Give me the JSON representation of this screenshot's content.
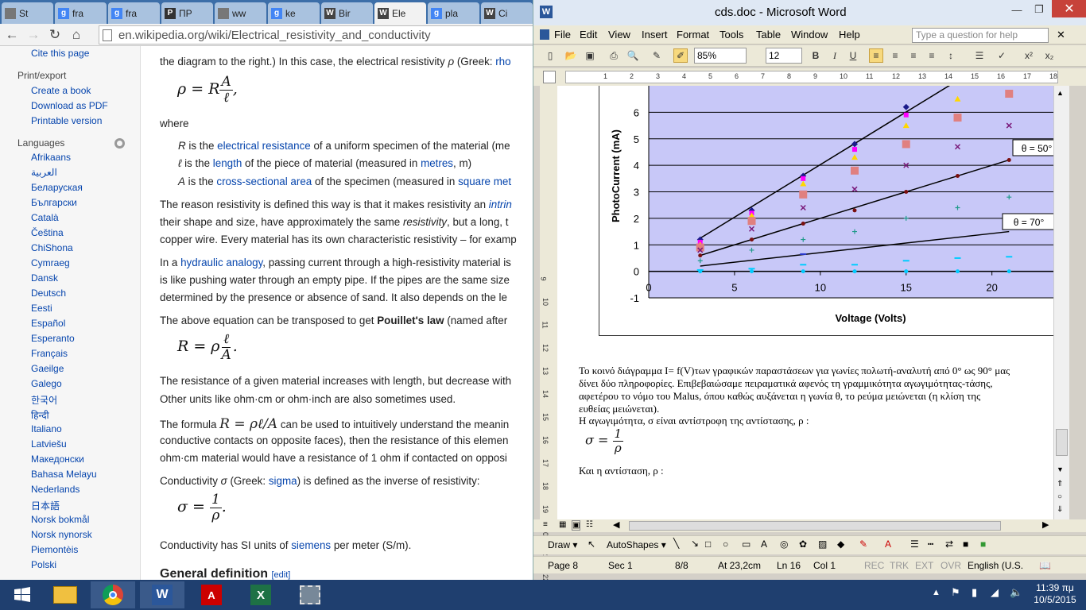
{
  "chrome": {
    "tabs": [
      {
        "label": "St",
        "fav": "page-icon"
      },
      {
        "label": "fra",
        "fav": "google-icon"
      },
      {
        "label": "fra",
        "fav": "google-icon"
      },
      {
        "label": "ΠΡ",
        "fav": "pdf-icon"
      },
      {
        "label": "ww",
        "fav": "page-icon"
      },
      {
        "label": "ke",
        "fav": "google-icon"
      },
      {
        "label": "Bir",
        "fav": "wikipedia-icon"
      },
      {
        "label": "Ele",
        "fav": "wikipedia-icon"
      },
      {
        "label": "pla",
        "fav": "google-icon"
      },
      {
        "label": "Ci",
        "fav": "wikipedia-icon"
      }
    ],
    "url": "en.wikipedia.org/wiki/Electrical_resistivity_and_conductivity"
  },
  "sidebar": {
    "cite": "Cite this page",
    "print_header": "Print/export",
    "print_items": [
      "Create a book",
      "Download as PDF",
      "Printable version"
    ],
    "languages_header": "Languages",
    "languages": [
      "Afrikaans",
      "العربية",
      "Беларуская",
      "Български",
      "Català",
      "Čeština",
      "ChiShona",
      "Cymraeg",
      "Dansk",
      "Deutsch",
      "Eesti",
      "Español",
      "Esperanto",
      "Français",
      "Gaeilge",
      "Galego",
      "한국어",
      "हिन्दी",
      "Italiano",
      "Latviešu",
      "Македонски",
      "Bahasa Melayu",
      "Nederlands",
      "日本語",
      "Norsk bokmål",
      "Norsk nynorsk",
      "Piemontèis",
      "Polski"
    ]
  },
  "article": {
    "l1a": "the diagram to the right.) In this case, the electrical resistivity ",
    "l1b": "ρ",
    "l1c": " (Greek: ",
    "l1d": "rho",
    "eq1_lhs": "ρ = R",
    "eq1_num": "A",
    "eq1_den": "ℓ",
    "eq1_tail": ",",
    "where": "where",
    "d1a": "R",
    "d1b": " is the ",
    "d1c": "electrical resistance",
    "d1d": " of a uniform specimen of the material (me",
    "d2a": "ℓ",
    "d2b": " is the ",
    "d2c": "length",
    "d2d": " of the piece of material (measured in ",
    "d2e": "metres",
    "d2f": ", m)",
    "d3a": "A",
    "d3b": " is the ",
    "d3c": "cross-sectional area",
    "d3d": " of the specimen (measured in ",
    "d3e": "square met",
    "p1a": "The reason resistivity is defined this way is that it makes resistivity an ",
    "p1b": "intrin",
    "p2a": "their shape and size, have approximately the same ",
    "p2b": "resistivity",
    ", ": "",
    "p2c": ", but a long, t",
    "p3": "copper wire. Every material has its own characteristic resistivity – for examp",
    "p4a": "In a ",
    "p4b": "hydraulic analogy",
    "p4c": ", passing current through a high-resistivity material is",
    "p5": "is like pushing water through an empty pipe. If the pipes are the same size",
    "p6": "determined by the presence or absence of sand. It also depends on the le",
    "p7a": "The above equation can be transposed to get ",
    "p7b": "Pouillet's law",
    "p7c": " (named after",
    "eq2_lhs": "R = ρ",
    "eq2_num": "ℓ",
    "eq2_den": "A",
    "eq2_tail": ".",
    "p8": "The resistance of a given material increases with length, but decrease with",
    "p9": "Other units like ohm·cm or ohm·inch are also sometimes used.",
    "p10a": "The formula ",
    "p10b": "R = ρℓ/A",
    "p10c": " can be used to intuitively understand the meanin",
    "p11": "conductive contacts on opposite faces), then the resistance of this elemen",
    "p12": "ohm·cm material would have a resistance of 1 ohm if contacted on opposi",
    "p13a": "Conductivity ",
    "p13b": "σ",
    "p13c": " (Greek: ",
    "p13d": "sigma",
    "p13e": ") is defined as the inverse of resistivity:",
    "eq3_lhs": "σ = ",
    "eq3_num": "1",
    "eq3_den": "ρ",
    "eq3_tail": ".",
    "p14a": "Conductivity has SI units of ",
    "p14b": "siemens",
    "p14c": " per meter (S/m).",
    "h2": "General definition",
    "edit": "[edit]"
  },
  "word": {
    "title": "cds.doc - Microsoft Word",
    "menus": [
      "File",
      "Edit",
      "View",
      "Insert",
      "Format",
      "Tools",
      "Table",
      "Window",
      "Help"
    ],
    "help_placeholder": "Type a question for help",
    "zoom": "85%",
    "font_size": "12",
    "status": {
      "page": "Page 8",
      "sec": "Sec 1",
      "pages": "8/8",
      "at": "At 23,2cm",
      "ln": "Ln 16",
      "col": "Col 1",
      "rec": "REC",
      "trk": "TRK",
      "ext": "EXT",
      "ovr": "OVR",
      "lang": "English (U.S."
    },
    "draw_label": "Draw ▾",
    "autoshapes_label": "AutoShapes ▾",
    "greek_text": [
      "Το κοινό διάγραμμα I= f(V)των γραφικών παραστάσεων για γωνίες πολωτή-αναλυτή από 0° ως 90° μας",
      "δίνει δύο πληροφορίες. Επιβεβαιώσαμε πειραματικά αφενός τη γραμμικότητα αγωγιμότητας-τάσης,",
      "αφετέρου το νόμο του Malus, όπου καθώς αυξάνεται η γωνία θ, το ρεύμα μειώνεται (η κλίση της",
      "ευθείας μειώνεται).",
      "Η αγωγιμότητα, σ είναι αντίστροφη της αντίστασης, ρ :"
    ],
    "eq_lhs": "σ =",
    "eq_num": "1",
    "eq_den": "ρ",
    "last_line": "Και η αντίσταση, ρ :"
  },
  "chart_data": {
    "type": "scatter",
    "xlabel": "Voltage (Volts)",
    "ylabel": "PhotoCurrent (mA)",
    "xlim": [
      0,
      24
    ],
    "ylim": [
      -1,
      7
    ],
    "xticks": [
      0,
      5,
      10,
      15,
      20
    ],
    "yticks": [
      -1,
      0,
      1,
      2,
      3,
      4,
      5,
      6
    ],
    "annotations": [
      "θ = 50°",
      "θ = 70°"
    ],
    "series": [
      {
        "color": "#1a1a8a",
        "marker": "diamond",
        "x": [
          3,
          6,
          9,
          12,
          15
        ],
        "y": [
          1.2,
          2.3,
          3.6,
          4.8,
          6.2
        ]
      },
      {
        "color": "#ff00ff",
        "marker": "square",
        "x": [
          3,
          6,
          9,
          12,
          15
        ],
        "y": [
          1.1,
          2.2,
          3.5,
          4.6,
          5.9
        ]
      },
      {
        "color": "#ffd700",
        "marker": "triangle",
        "x": [
          3,
          6,
          9,
          12,
          15,
          18
        ],
        "y": [
          1.0,
          2.1,
          3.3,
          4.3,
          5.5,
          6.5
        ]
      },
      {
        "color": "#e08080",
        "marker": "bigsquare",
        "x": [
          3,
          6,
          9,
          12,
          15,
          18,
          21
        ],
        "y": [
          0.9,
          1.9,
          2.9,
          3.8,
          4.8,
          5.8,
          6.7
        ]
      },
      {
        "color": "#7a1a7a",
        "marker": "x",
        "x": [
          3,
          6,
          9,
          12,
          15,
          18,
          21
        ],
        "y": [
          0.8,
          1.6,
          2.4,
          3.1,
          4.0,
          4.7,
          5.5
        ]
      },
      {
        "color": "#7a1010",
        "marker": "circle",
        "x": [
          3,
          6,
          9,
          12,
          15,
          18,
          21
        ],
        "y": [
          0.6,
          1.2,
          1.8,
          2.3,
          3.0,
          3.6,
          4.2
        ]
      },
      {
        "color": "#1f9a8a",
        "marker": "plus",
        "x": [
          3,
          6,
          9,
          12,
          15,
          18,
          21
        ],
        "y": [
          0.4,
          0.8,
          1.2,
          1.5,
          2.0,
          2.4,
          2.8
        ]
      },
      {
        "color": "#2a3ad0",
        "marker": "dash",
        "x": [
          9
        ],
        "y": [
          0.65
        ]
      },
      {
        "color": "#00ccff",
        "marker": "dash",
        "x": [
          3,
          6,
          9,
          12,
          15,
          18,
          21
        ],
        "y": [
          0.05,
          0.1,
          0.25,
          0.25,
          0.4,
          0.5,
          0.55
        ]
      },
      {
        "color": "#00ccff",
        "marker": "circle",
        "x": [
          3,
          6,
          9,
          12,
          15,
          18,
          21
        ],
        "y": [
          0,
          0,
          0,
          0,
          0,
          0,
          0
        ]
      }
    ],
    "fit_lines": [
      {
        "x": [
          3,
          18
        ],
        "y": [
          1.25,
          7.2
        ]
      },
      {
        "x": [
          3,
          21
        ],
        "y": [
          0.6,
          4.2
        ]
      },
      {
        "x": [
          3,
          21
        ],
        "y": [
          0.2,
          1.5
        ]
      }
    ]
  },
  "taskbar": {
    "apps": [
      "file-explorer-icon",
      "chrome-icon",
      "word-icon",
      "acrobat-icon",
      "excel-icon",
      "screenshot-tool-icon"
    ],
    "time": "11:39 πμ",
    "date": "10/5/2015"
  }
}
